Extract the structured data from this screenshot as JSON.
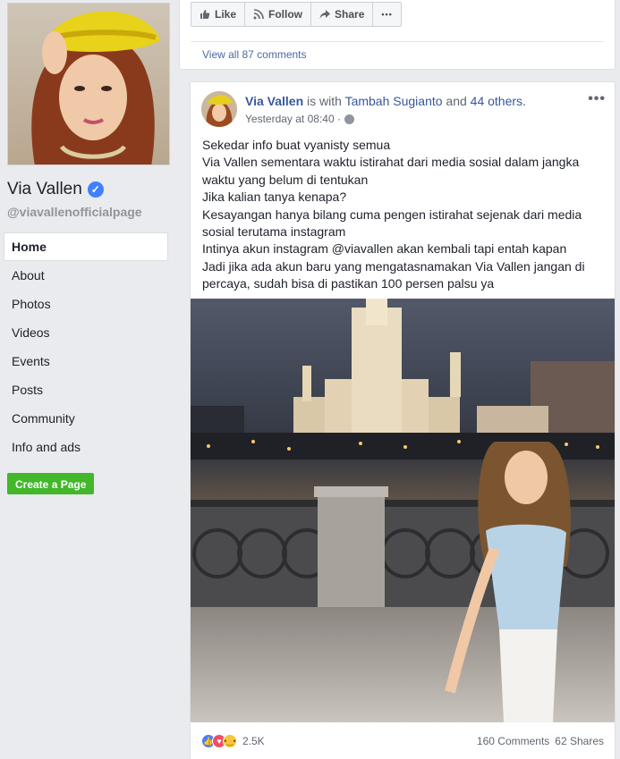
{
  "sidebar": {
    "page_name": "Via Vallen",
    "handle": "@viavallenofficialpage",
    "nav": [
      "Home",
      "About",
      "Photos",
      "Videos",
      "Events",
      "Posts",
      "Community",
      "Info and ads"
    ],
    "active_nav": "Home",
    "create_page": "Create a Page"
  },
  "top_card": {
    "actions": [
      {
        "label": "Like",
        "icon": "thumbs-up-icon"
      },
      {
        "label": "Follow",
        "icon": "rss-icon"
      },
      {
        "label": "Share",
        "icon": "share-arrow-icon"
      }
    ],
    "more": "•••",
    "view_comments": "View all 87 comments"
  },
  "post": {
    "author": "Via Vallen",
    "is_with": " is with ",
    "tagged": "Tambah Sugianto",
    "and": " and ",
    "others": "44 others.",
    "time": "Yesterday at 08:40 ·",
    "more": "•••",
    "lines": [
      "Sekedar info buat vyanisty semua",
      "Via Vallen sementara waktu istirahat dari media sosial dalam jangka",
      "waktu yang belum di tentukan",
      "Jika kalian tanya kenapa?",
      "Kesayangan hanya bilang cuma pengen istirahat sejenak dari media",
      "sosial terutama instagram",
      "Intinya akun instagram @viavallen akan kembali tapi entah kapan",
      "Jadi jika ada akun baru yang mengatasnamakan Via Vallen jangan di",
      "percaya, sudah bisa di pastikan 100 persen palsu ya"
    ],
    "reaction_count": "2.5K",
    "comments": "160 Comments",
    "shares": "62 Shares"
  },
  "colors": {
    "link": "#365899",
    "green": "#42b72a",
    "background": "#e9ebee"
  }
}
